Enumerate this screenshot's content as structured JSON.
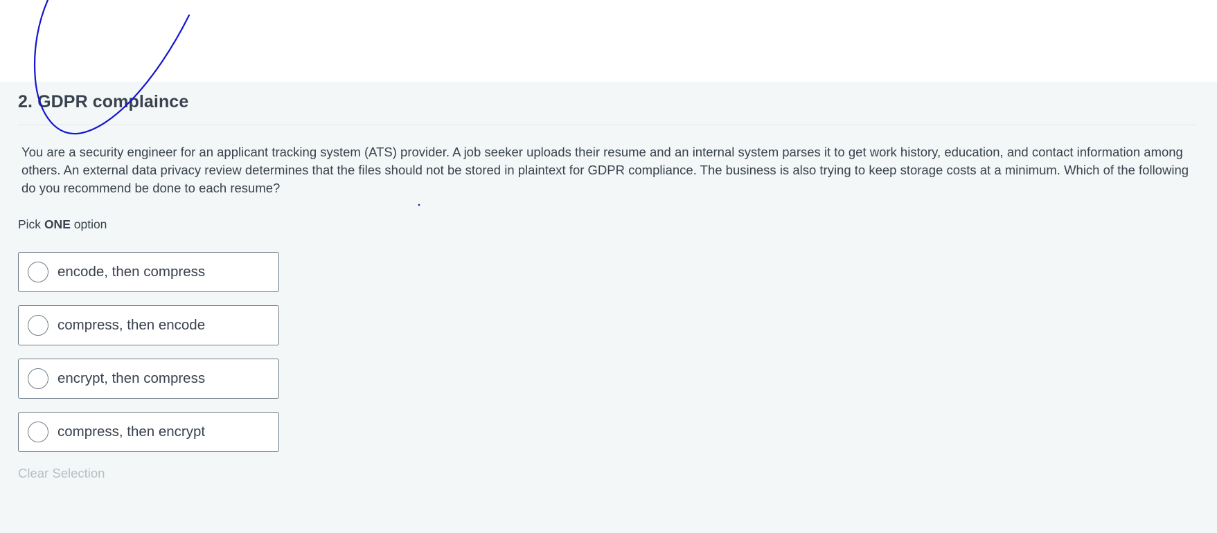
{
  "question": {
    "title": "2. GDPR complaince",
    "body": "You are a security engineer for an applicant tracking system (ATS) provider. A job seeker uploads their resume and an internal system parses it to get work history, education, and contact information among others. An external data privacy review determines that the files should not be stored in plaintext for GDPR compliance. The business is also trying to keep storage costs at a minimum. Which of the following do you recommend be done to each resume?",
    "pick_prefix": "Pick ",
    "pick_emphasis": "ONE",
    "pick_suffix": " option",
    "options": [
      {
        "label": "encode, then compress",
        "selected": false
      },
      {
        "label": "compress, then encode",
        "selected": false
      },
      {
        "label": "encrypt, then compress",
        "selected": false
      },
      {
        "label": "compress, then encrypt",
        "selected": false
      }
    ],
    "clear_label": "Clear Selection"
  },
  "annotation": {
    "color": "#1414d2"
  }
}
